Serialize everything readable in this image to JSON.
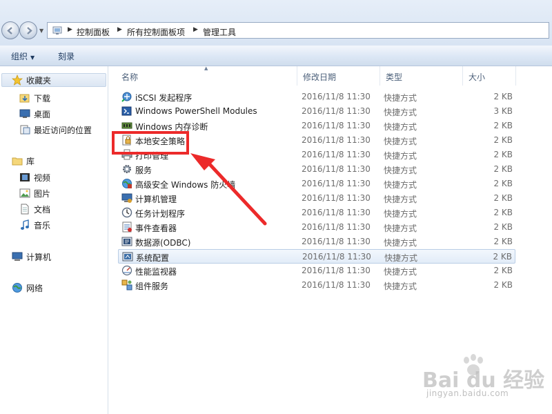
{
  "address_bar": {
    "crumbs": [
      "控制面板",
      "所有控制面板项",
      "管理工具"
    ]
  },
  "toolbar": {
    "organize_label": "组织",
    "burn_label": "刻录"
  },
  "nav": {
    "favorites_label": "收藏夹",
    "favorites_items": [
      "下载",
      "桌面",
      "最近访问的位置"
    ],
    "libraries_label": "库",
    "libraries_items": [
      "视频",
      "图片",
      "文档",
      "音乐"
    ],
    "computer_label": "计算机",
    "network_label": "网络"
  },
  "columns": {
    "name": "名称",
    "date": "修改日期",
    "type": "类型",
    "size": "大小"
  },
  "files": [
    {
      "name": "iSCSI 发起程序",
      "date": "2016/11/8 11:30",
      "type": "快捷方式",
      "size": "2 KB",
      "icon": "iscsi-icon"
    },
    {
      "name": "Windows PowerShell Modules",
      "date": "2016/11/8 11:30",
      "type": "快捷方式",
      "size": "3 KB",
      "icon": "powershell-icon"
    },
    {
      "name": "Windows 内存诊断",
      "date": "2016/11/8 11:30",
      "type": "快捷方式",
      "size": "2 KB",
      "icon": "memory-diagnostic-icon"
    },
    {
      "name": "本地安全策略",
      "date": "2016/11/8 11:30",
      "type": "快捷方式",
      "size": "2 KB",
      "icon": "security-policy-icon"
    },
    {
      "name": "打印管理",
      "date": "2016/11/8 11:30",
      "type": "快捷方式",
      "size": "2 KB",
      "icon": "print-management-icon"
    },
    {
      "name": "服务",
      "date": "2016/11/8 11:30",
      "type": "快捷方式",
      "size": "2 KB",
      "icon": "services-icon"
    },
    {
      "name": "高级安全 Windows 防火墙",
      "date": "2016/11/8 11:30",
      "type": "快捷方式",
      "size": "2 KB",
      "icon": "firewall-icon"
    },
    {
      "name": "计算机管理",
      "date": "2016/11/8 11:30",
      "type": "快捷方式",
      "size": "2 KB",
      "icon": "computer-management-icon"
    },
    {
      "name": "任务计划程序",
      "date": "2016/11/8 11:30",
      "type": "快捷方式",
      "size": "2 KB",
      "icon": "task-scheduler-icon"
    },
    {
      "name": "事件查看器",
      "date": "2016/11/8 11:30",
      "type": "快捷方式",
      "size": "2 KB",
      "icon": "event-viewer-icon"
    },
    {
      "name": "数据源(ODBC)",
      "date": "2016/11/8 11:30",
      "type": "快捷方式",
      "size": "2 KB",
      "icon": "odbc-icon"
    },
    {
      "name": "系统配置",
      "date": "2016/11/8 11:30",
      "type": "快捷方式",
      "size": "2 KB",
      "icon": "system-config-icon"
    },
    {
      "name": "性能监视器",
      "date": "2016/11/8 11:30",
      "type": "快捷方式",
      "size": "2 KB",
      "icon": "performance-monitor-icon"
    },
    {
      "name": "组件服务",
      "date": "2016/11/8 11:30",
      "type": "快捷方式",
      "size": "2 KB",
      "icon": "component-services-icon"
    }
  ],
  "watermark": {
    "logo_text": "Bai du 经验",
    "url": "jingyan.baidu.com"
  },
  "colors": {
    "annotation_red": "#ec2a2a",
    "header_text": "#4c607a",
    "selection_border": "#b9cde5"
  }
}
